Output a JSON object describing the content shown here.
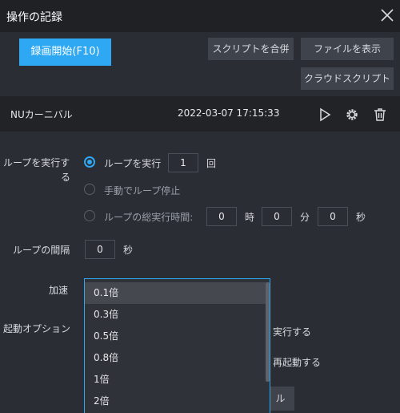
{
  "window": {
    "title": "操作の記録",
    "close_icon": "close-icon"
  },
  "toolbar": {
    "record_label": "録画開始(F10)",
    "merge_label": "スクリプトを合併",
    "show_file_label": "ファイルを表示",
    "cloud_label": "クラウドスクリプト"
  },
  "script": {
    "name": "NUカーニバル",
    "datetime": "2022-03-07 17:15:33",
    "icons": [
      "play-icon",
      "gear-icon",
      "trash-icon"
    ]
  },
  "loop": {
    "label_line1": "ループを実行す",
    "label_line2": "る",
    "option_repeat": "ループを実行",
    "repeat_count": "1",
    "repeat_unit": "回",
    "option_manual": "手動でループ停止",
    "option_total": "ループの総実行時間:",
    "hours": "0",
    "hours_unit": "時",
    "minutes": "0",
    "minutes_unit": "分",
    "seconds": "0",
    "seconds_unit": "秒"
  },
  "interval": {
    "label": "ループの間隔",
    "value": "0",
    "unit": "秒"
  },
  "speed": {
    "label": "加速",
    "options": [
      "0.1倍",
      "0.3倍",
      "0.5倍",
      "0.8倍",
      "1倍",
      "2倍"
    ],
    "selected": "0.1倍"
  },
  "startup": {
    "label": "起動オプション",
    "option1_partial": "実行する",
    "option2_partial": "再起動する",
    "button_partial": "ル"
  },
  "colors": {
    "accent": "#2ea8f3",
    "background": "#2a2d33",
    "titlebar": "#1f2125"
  }
}
